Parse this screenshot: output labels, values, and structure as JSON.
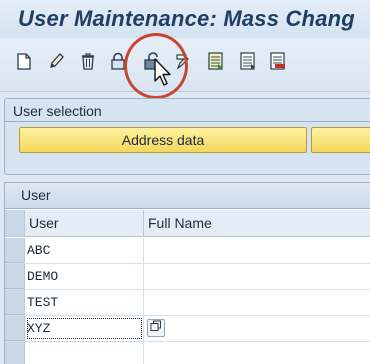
{
  "window": {
    "title": "User Maintenance: Mass Chang"
  },
  "toolbar": {
    "buttons": [
      {
        "icon": "new-document-icon"
      },
      {
        "icon": "pencil-icon"
      },
      {
        "icon": "trash-icon"
      },
      {
        "icon": "lock-icon"
      },
      {
        "icon": "unlock-icon"
      },
      {
        "icon": "edit-variant-icon"
      },
      {
        "icon": "list-icon"
      },
      {
        "icon": "list-detail-icon"
      },
      {
        "icon": "list-remove-icon"
      }
    ],
    "highlight_color": "#c8462f"
  },
  "user_selection": {
    "title": "User selection",
    "tabs": [
      {
        "label": "Address data"
      },
      {
        "label": ""
      }
    ]
  },
  "user_table": {
    "title": "User",
    "columns": [
      "User",
      "Full Name"
    ],
    "rows": [
      {
        "user": "ABC",
        "full_name": ""
      },
      {
        "user": "DEMO",
        "full_name": ""
      },
      {
        "user": "TEST",
        "full_name": ""
      },
      {
        "user": "XYZ",
        "full_name": ""
      },
      {
        "user": "",
        "full_name": ""
      }
    ]
  },
  "colors": {
    "background": "#dde8f3",
    "title": "#1f3f63",
    "tab_yellow": "#f3d65c"
  }
}
